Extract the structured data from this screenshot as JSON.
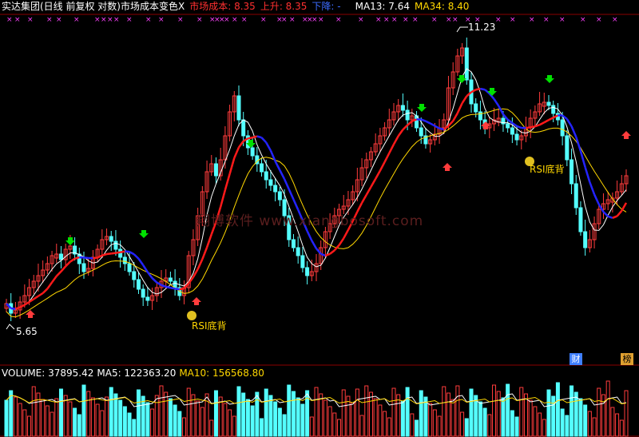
{
  "header": {
    "stock_name": "实达集团(日线 前复权 对数)",
    "indicator": "市场成本变色X",
    "cost_label": "市场成本: 8.35",
    "up_label": "上升: 8.35",
    "down_label": "下降: -",
    "ma13_label": "MA13: 7.64",
    "ma34_label": "MA34: 8.40"
  },
  "annotations": {
    "high_price": "11.23",
    "low_price": "5.65",
    "rsi_label_1": "RSI底背",
    "rsi_label_2": "RSI底背",
    "watermark": "翔博软件 www.xiangbosoft.com"
  },
  "volume_header": {
    "volume_label": "VOLUME: 37895.42",
    "ma5_label": "MA5: 122363.20",
    "ma10_label": "MA10: 156568.80"
  },
  "badges": {
    "finance": "财",
    "list": "榜"
  },
  "colors": {
    "up": "#ff3c3c",
    "down": "#54ffff",
    "cost_up": "#ff1a1a",
    "cost_down": "#2424ff",
    "ma13": "#ffffff",
    "ma34": "#ffd700",
    "green_arrow": "#00e000",
    "red_arrow": "#ff3c3c",
    "markers": "#ff40ff"
  }
}
